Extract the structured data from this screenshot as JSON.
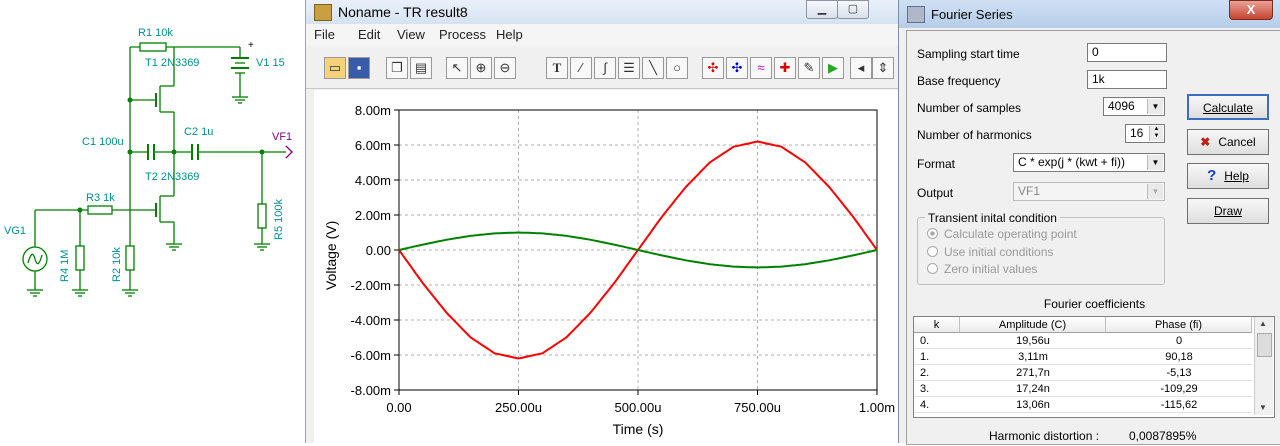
{
  "schematic": {
    "labels": {
      "r1": "R1 10k",
      "t1": "T1 2N3369",
      "v1": "V1 15",
      "c1": "C1 100u",
      "c2": "C2 1u",
      "vf1": "VF1",
      "t2": "T2 2N3369",
      "r3": "R3 1k",
      "vg1": "VG1",
      "r4": "R4 1M",
      "r2": "R2 10k",
      "r5": "R5 100k",
      "plus": "+"
    },
    "colors": {
      "wire": "#008000",
      "label": "#009090",
      "probe": "#800080"
    }
  },
  "tr_window": {
    "title": "Noname - TR result8",
    "menu": [
      "File",
      "Edit",
      "View",
      "Process",
      "Help"
    ],
    "toolbar_icons": [
      "open-icon",
      "save-icon",
      "copy-icon",
      "paste-icon",
      "cursor-icon",
      "zoom-in-icon",
      "zoom-100-icon",
      "text-icon",
      "line-tool-icon",
      "curve-tool-icon",
      "label-tool-icon",
      "line-icon",
      "circle-icon",
      "cursor-a-icon",
      "cursor-b-icon",
      "wave-icon",
      "marker-icon",
      "pen-icon",
      "run-icon",
      "back-icon",
      "up-down-icon",
      "forward-icon"
    ]
  },
  "chart_data": {
    "type": "line",
    "xlabel": "Time (s)",
    "ylabel": "Voltage (V)",
    "xlim": [
      0,
      1.0
    ],
    "ylim": [
      -8.0,
      8.0
    ],
    "x_tick_labels": [
      "0.00",
      "250.00u",
      "500.00u",
      "750.00u",
      "1.00m"
    ],
    "x_ticks": [
      0,
      0.25,
      0.5,
      0.75,
      1.0
    ],
    "y_tick_labels": [
      "8.00m",
      "6.00m",
      "4.00m",
      "2.00m",
      "0.00",
      "-2.00m",
      "-4.00m",
      "-6.00m",
      "-8.00m"
    ],
    "y_ticks": [
      8,
      6,
      4,
      2,
      0,
      -2,
      -4,
      -6,
      -8
    ],
    "grid": true,
    "series": [
      {
        "color": "#ff0000",
        "x": [
          0,
          0.05,
          0.1,
          0.15,
          0.2,
          0.25,
          0.3,
          0.35,
          0.4,
          0.45,
          0.5,
          0.55,
          0.6,
          0.65,
          0.7,
          0.75,
          0.8,
          0.85,
          0.9,
          0.95,
          1.0
        ],
        "y": [
          0,
          -1.9,
          -3.6,
          -5.0,
          -5.9,
          -6.2,
          -5.9,
          -5.0,
          -3.6,
          -1.9,
          0,
          1.9,
          3.6,
          5.0,
          5.9,
          6.2,
          5.9,
          5.0,
          3.6,
          1.9,
          0
        ]
      },
      {
        "color": "#008000",
        "x": [
          0,
          0.05,
          0.1,
          0.15,
          0.2,
          0.25,
          0.3,
          0.35,
          0.4,
          0.45,
          0.5,
          0.55,
          0.6,
          0.65,
          0.7,
          0.75,
          0.8,
          0.85,
          0.9,
          0.95,
          1.0
        ],
        "y": [
          0,
          0.31,
          0.59,
          0.81,
          0.95,
          1.0,
          0.95,
          0.81,
          0.59,
          0.31,
          0,
          -0.31,
          -0.59,
          -0.81,
          -0.95,
          -1.0,
          -0.95,
          -0.81,
          -0.59,
          -0.31,
          0
        ]
      }
    ]
  },
  "fourier": {
    "title": "Fourier Series",
    "close_label": "X",
    "sampling_start_label": "Sampling start time",
    "sampling_start_value": "0",
    "base_freq_label": "Base frequency",
    "base_freq_value": "1k",
    "num_samples_label": "Number of samples",
    "num_samples_value": "4096",
    "num_harmonics_label": "Number of harmonics",
    "num_harmonics_value": "16",
    "format_label": "Format",
    "format_value": "C * exp(j * (kwt + fi))",
    "output_label": "Output",
    "output_value": "VF1",
    "transient_label": "Transient inital condition",
    "radio_options": [
      "Calculate operating point",
      "Use initial conditions",
      "Zero initial values"
    ],
    "buttons": {
      "calculate": "Calculate",
      "cancel": "Cancel",
      "help": "Help",
      "draw": "Draw"
    },
    "coef_title": "Fourier coefficients",
    "columns": [
      "k",
      "Amplitude (C)",
      "Phase (fi)"
    ],
    "rows": [
      [
        "0.",
        "19,56u",
        "0"
      ],
      [
        "1.",
        "3,11m",
        "90,18"
      ],
      [
        "2.",
        "271,7n",
        "-5,13"
      ],
      [
        "3.",
        "17,24n",
        "-109,29"
      ],
      [
        "4.",
        "13,06n",
        "-115,62"
      ]
    ],
    "distortion_label": "Harmonic distortion :",
    "distortion_value": "0,0087895%"
  }
}
